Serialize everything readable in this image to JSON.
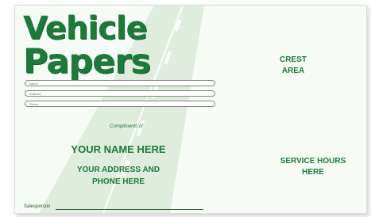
{
  "title": {
    "line1": "Vehicle",
    "line2": "Papers"
  },
  "fields": {
    "name": "Name",
    "address": "Address",
    "phone": "Phone"
  },
  "compliments": "Compliments of",
  "your_name": "YOUR NAME HERE",
  "your_address_line1": "YOUR ADDRESS AND",
  "your_address_line2": "PHONE HERE",
  "crest_line1": "CREST",
  "crest_line2": "AREA",
  "service_line1": "SERVICE HOURS",
  "service_line2": "HERE",
  "salesperson": "Salesperson",
  "colors": {
    "brand_green": "#1e7a3a",
    "background": "#f7fbf6"
  }
}
